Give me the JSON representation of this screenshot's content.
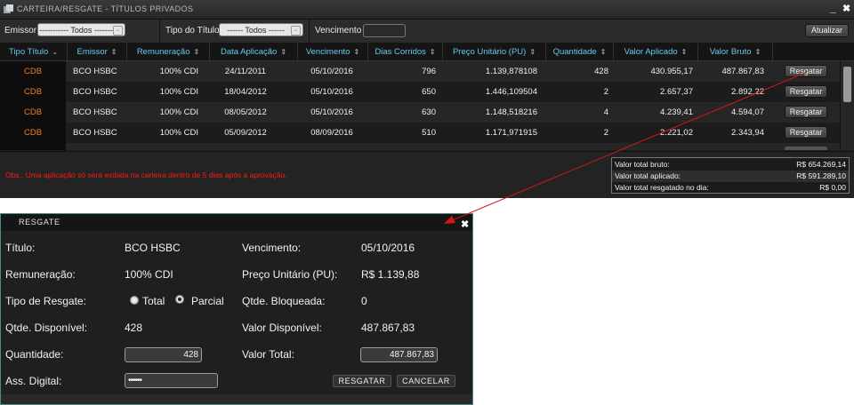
{
  "window": {
    "title": "CARTEIRA/RESGATE - TÍTULOS PRIVADOS",
    "min_icon": "minimize-icon",
    "close_icon": "close-icon"
  },
  "filters": {
    "emissor_label": "Emissor",
    "emissor_value": "----------- Todos -----------",
    "tipo_label": "Tipo do Título",
    "tipo_value": "------ Todos ------",
    "vencimento_label": "Vencimento",
    "atualizar": "Atualizar"
  },
  "table": {
    "columns": [
      "Tipo Título",
      "Emissor",
      "Remuneração",
      "Data Aplicação",
      "Vencimento",
      "Dias Corridos",
      "Preço Unitário (PU)",
      "Quantidade",
      "Valor Aplicado",
      "Valor Bruto"
    ],
    "rows": [
      [
        "CDB",
        "BCO HSBC",
        "100% CDI",
        "24/11/2011",
        "05/10/2016",
        "796",
        "1.139,878108",
        "428",
        "430.955,17",
        "487.867,83"
      ],
      [
        "CDB",
        "BCO HSBC",
        "100% CDI",
        "18/04/2012",
        "05/10/2016",
        "650",
        "1.446,109504",
        "2",
        "2.657,37",
        "2.892,22"
      ],
      [
        "CDB",
        "BCO HSBC",
        "100% CDI",
        "08/05/2012",
        "05/10/2016",
        "630",
        "1.148,518216",
        "4",
        "4.239,41",
        "4.594,07"
      ],
      [
        "CDB",
        "BCO HSBC",
        "100% CDI",
        "05/09/2012",
        "08/09/2016",
        "510",
        "1.171,971915",
        "2",
        "2.221,02",
        "2.343,94"
      ]
    ],
    "row_button": "Resgatar"
  },
  "footer": {
    "obs": "Obs.: Uma aplicação só será exibida na carteira dentro de 5 dias após a aprovação.",
    "totals": [
      {
        "label": "Valor total bruto:",
        "value": "R$ 654.269,14"
      },
      {
        "label": "Valor total aplicado:",
        "value": "R$ 591.289,10"
      },
      {
        "label": "Valor total resgatado no dia:",
        "value": "R$ 0,00"
      }
    ]
  },
  "dialog": {
    "title": "RESGATE",
    "titulo_label": "Título:",
    "titulo_value": "BCO HSBC",
    "vencimento_label": "Vencimento:",
    "vencimento_value": "05/10/2016",
    "remuneracao_label": "Remuneração:",
    "remuneracao_value": "100% CDI",
    "pu_label": "Preço Unitário (PU):",
    "pu_value": "R$ 1.139,88",
    "tipo_label": "Tipo de Resgate:",
    "tipo_total": "Total",
    "tipo_parcial": "Parcial",
    "tipo_selected": "Parcial",
    "bloqueada_label": "Qtde. Bloqueada:",
    "bloqueada_value": "0",
    "disponivel_label": "Qtde. Disponível:",
    "disponivel_value": "428",
    "valor_disp_label": "Valor Disponível:",
    "valor_disp_value": "487.867,83",
    "quantidade_label": "Quantidade:",
    "quantidade_value": "428",
    "valor_total_label": "Valor Total:",
    "valor_total_value": "487.867,83",
    "assinatura_label": "Ass. Digital:",
    "assinatura_value": "••••••",
    "resgatar": "RESGATAR",
    "cancelar": "CANCELAR"
  },
  "colors": {
    "accent": "#66c8e8",
    "tipo": "#f07d2a",
    "warning": "#ff1a1a",
    "arrow": "#d01818"
  }
}
